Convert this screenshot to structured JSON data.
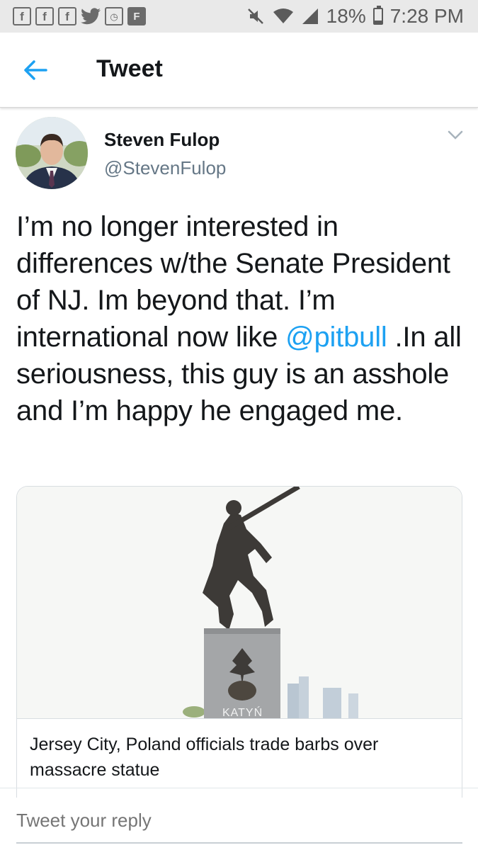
{
  "status_bar": {
    "app_icons": [
      "f",
      "f",
      "f",
      "twitter-bird",
      "time-app",
      "flipboard"
    ],
    "battery": "18%",
    "time": "7:28 PM"
  },
  "header": {
    "title": "Tweet"
  },
  "tweet": {
    "author_name": "Steven Fulop",
    "author_handle": "@StevenFulop",
    "text_before": "I’m no longer interested in differences w/the Senate President of NJ. Im beyond that. I’m international now like ",
    "mention": "@pitbull",
    "text_after": " .In all seriousness, this guy is an asshole and I’m happy he engaged me.",
    "card": {
      "image_watermark": "KATYŃ",
      "caption": "Jersey City, Poland officials trade barbs over massacre statue"
    }
  },
  "reply": {
    "placeholder": "Tweet your reply"
  },
  "colors": {
    "link": "#1da1f2",
    "secondary_text": "#657786",
    "status_bar_bg": "#e9e9e9"
  }
}
